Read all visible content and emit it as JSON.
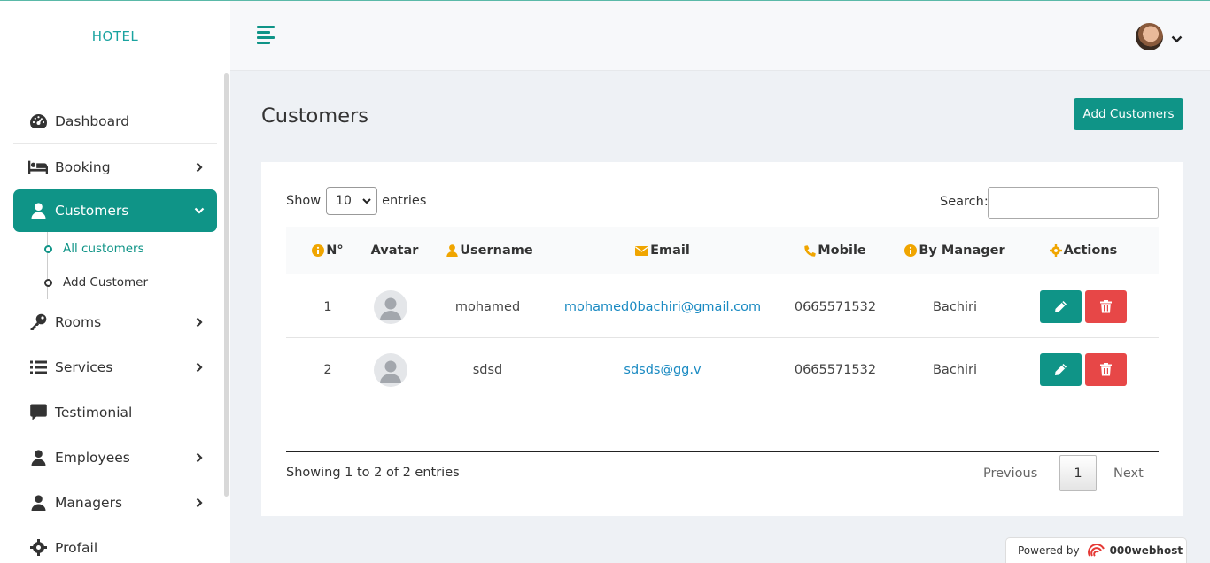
{
  "brand": "HOTEL",
  "sidebar": {
    "items": [
      {
        "label": "Dashboard",
        "icon": "dashboard-icon"
      },
      {
        "label": "Booking",
        "icon": "bed-icon"
      },
      {
        "label": "Customers",
        "icon": "user-icon"
      },
      {
        "label": "Rooms",
        "icon": "key-icon"
      },
      {
        "label": "Services",
        "icon": "list-icon"
      },
      {
        "label": "Testimonial",
        "icon": "comment-icon"
      },
      {
        "label": "Employees",
        "icon": "user-icon"
      },
      {
        "label": "Managers",
        "icon": "user-icon"
      },
      {
        "label": "Profail",
        "icon": "gear-icon"
      }
    ],
    "submenu": [
      "All customers",
      "Add Customer"
    ]
  },
  "main": {
    "title": "Customers",
    "add_button": "Add Customers",
    "show_label": "Show",
    "page_size": "10",
    "entries_label": "entries",
    "search_label": "Search:",
    "search_value": ""
  },
  "table": {
    "headers": [
      "N°",
      "Avatar",
      "Username",
      "Email",
      "Mobile",
      "By Manager",
      "Actions"
    ],
    "rows": [
      {
        "n": "1",
        "username": "mohamed",
        "email": "mohamed0bachiri@gmail.com",
        "mobile": "0665571532",
        "manager": "Bachiri"
      },
      {
        "n": "2",
        "username": "sdsd",
        "email": "sdsds@gg.v",
        "mobile": "0665571532",
        "manager": "Bachiri"
      }
    ],
    "info": "Showing 1 to 2 of 2 entries",
    "pagination": {
      "prev": "Previous",
      "current": "1",
      "next": "Next"
    }
  },
  "footer": {
    "powered_by": "Powered by",
    "host": "000webhost"
  },
  "colors": {
    "accent": "#0f9487",
    "danger": "#e74747",
    "header_icon": "#f0a500",
    "link": "#1a8ac2"
  }
}
